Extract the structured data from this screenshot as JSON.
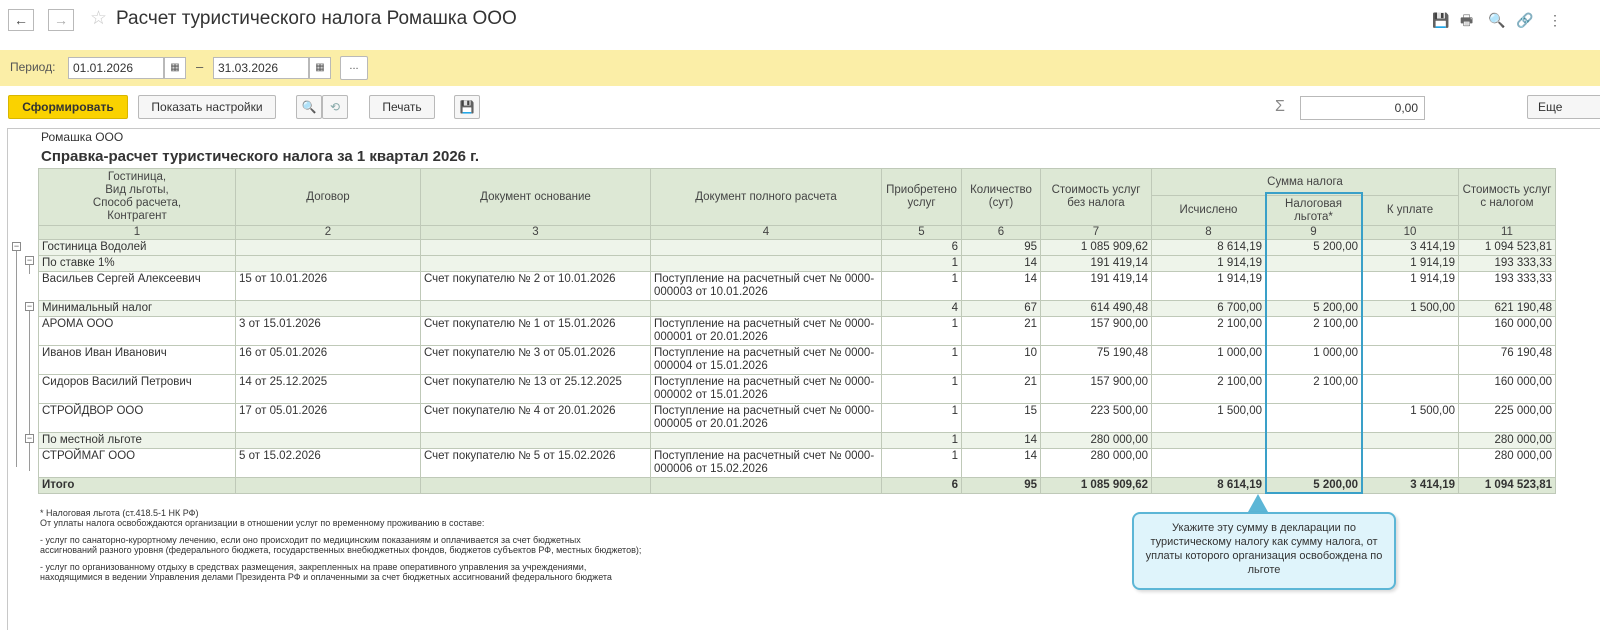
{
  "window": {
    "title": "Расчет туристического налога Ромашка ООО",
    "back_icon": "←",
    "forward_icon": "→",
    "star_icon": "☆",
    "toolbar_icons": [
      "💾",
      "🖶",
      "🔍",
      "🔗",
      "⋮"
    ]
  },
  "period": {
    "label": "Период:",
    "from": "01.01.2026",
    "to": "31.03.2026",
    "dash": "–",
    "dots": "..."
  },
  "toolbar": {
    "generate_label": "Сформировать",
    "settings_label": "Показать настройки",
    "search_icon": "🔍",
    "search_clear_icon": "⟲",
    "print_label": "Печать",
    "save_icon": "💾",
    "sigma": "Σ",
    "sum_value": "0,00",
    "more_label": "Еще"
  },
  "report": {
    "organization": "Ромашка ООО",
    "title": "Справка-расчет туристического налога за 1 квартал 2026 г.",
    "headers": {
      "col1": "Гостиница,\nВид льготы,\nСпособ расчета,\nКонтрагент",
      "col2": "Договор",
      "col3": "Документ основание",
      "col4": "Документ полного расчета",
      "col5": "Приобретено услуг",
      "col6": "Количество (сут)",
      "col7": "Стоимость услуг без налога",
      "tax_group": "Сумма налога",
      "col8": "Исчислено",
      "col9": "Налоговая льгота*",
      "col10": "К уплате",
      "col11": "Стоимость услуг с налогом"
    },
    "col_numbers": [
      "1",
      "2",
      "3",
      "4",
      "5",
      "6",
      "7",
      "8",
      "9",
      "10",
      "11"
    ],
    "rows": [
      {
        "level": 0,
        "name": "Гостиница Водолей",
        "contract": "",
        "basis": "",
        "payment": "",
        "services": "6",
        "days": "95",
        "cost": "1 085 909,62",
        "calc": "8 614,19",
        "benefit": "5 200,00",
        "pay": "3 414,19",
        "total": "1 094 523,81"
      },
      {
        "level": 1,
        "name": "По ставке 1%",
        "contract": "",
        "basis": "",
        "payment": "",
        "services": "1",
        "days": "14",
        "cost": "191 419,14",
        "calc": "1 914,19",
        "benefit": "",
        "pay": "1 914,19",
        "total": "193 333,33"
      },
      {
        "level": 2,
        "name": "Васильев Сергей Алексеевич",
        "contract": "15 от 10.01.2026",
        "basis": "Счет покупателю № 2 от 10.01.2026",
        "payment": "Поступление на расчетный счет № 0000-000003 от 10.01.2026",
        "services": "1",
        "days": "14",
        "cost": "191 419,14",
        "calc": "1 914,19",
        "benefit": "",
        "pay": "1 914,19",
        "total": "193 333,33"
      },
      {
        "level": 1,
        "name": "Минимальный налог",
        "contract": "",
        "basis": "",
        "payment": "",
        "services": "4",
        "days": "67",
        "cost": "614 490,48",
        "calc": "6 700,00",
        "benefit": "5 200,00",
        "pay": "1 500,00",
        "total": "621 190,48"
      },
      {
        "level": 2,
        "name": "АРОМА ООО",
        "contract": "3 от 15.01.2026",
        "basis": "Счет покупателю № 1 от 15.01.2026",
        "payment": "Поступление на расчетный счет № 0000-000001 от 20.01.2026",
        "services": "1",
        "days": "21",
        "cost": "157 900,00",
        "calc": "2 100,00",
        "benefit": "2 100,00",
        "pay": "",
        "total": "160 000,00"
      },
      {
        "level": 2,
        "name": "Иванов Иван Иванович",
        "contract": "16 от 05.01.2026",
        "basis": "Счет покупателю № 3 от 05.01.2026",
        "payment": "Поступление на расчетный счет № 0000-000004 от 15.01.2026",
        "services": "1",
        "days": "10",
        "cost": "75 190,48",
        "calc": "1 000,00",
        "benefit": "1 000,00",
        "pay": "",
        "total": "76 190,48"
      },
      {
        "level": 2,
        "name": "Сидоров Василий Петрович",
        "contract": "14 от 25.12.2025",
        "basis": "Счет покупателю № 13 от 25.12.2025",
        "payment": "Поступление на расчетный счет № 0000-000002 от 15.01.2026",
        "services": "1",
        "days": "21",
        "cost": "157 900,00",
        "calc": "2 100,00",
        "benefit": "2 100,00",
        "pay": "",
        "total": "160 000,00"
      },
      {
        "level": 2,
        "name": "СТРОЙДВОР ООО",
        "contract": "17 от 05.01.2026",
        "basis": "Счет покупателю № 4 от 20.01.2026",
        "payment": "Поступление на расчетный счет № 0000-000005 от 20.01.2026",
        "services": "1",
        "days": "15",
        "cost": "223 500,00",
        "calc": "1 500,00",
        "benefit": "",
        "pay": "1 500,00",
        "total": "225 000,00"
      },
      {
        "level": 1,
        "name": "По местной льготе",
        "contract": "",
        "basis": "",
        "payment": "",
        "services": "1",
        "days": "14",
        "cost": "280 000,00",
        "calc": "",
        "benefit": "",
        "pay": "",
        "total": "280 000,00"
      },
      {
        "level": 2,
        "name": "СТРОЙМАГ ООО",
        "contract": "5 от 15.02.2026",
        "basis": "Счет покупателю № 5 от 15.02.2026",
        "payment": "Поступление на расчетный счет № 0000-000006 от 15.02.2026",
        "services": "1",
        "days": "14",
        "cost": "280 000,00",
        "calc": "",
        "benefit": "",
        "pay": "",
        "total": "280 000,00"
      }
    ],
    "total": {
      "name": "Итого",
      "services": "6",
      "days": "95",
      "cost": "1 085 909,62",
      "calc": "8 614,19",
      "benefit": "5 200,00",
      "pay": "3 414,19",
      "total": "1 094 523,81"
    },
    "footnote": [
      "* Налоговая льгота (ст.418.5-1 НК РФ)",
      "От уплаты налога освобождаются организации в отношении услуг по временному проживанию в составе:",
      "",
      "- услуг по санаторно-курортному лечению, если оно происходит по медицинским показаниям и оплачивается за счет бюджетных",
      "ассигнований разного уровня (федерального бюджета, государственных внебюджетных фондов, бюджетов субъектов РФ, местных бюджетов);",
      "",
      "- услуг по организованному отдыху в средствах размещения, закрепленных на праве оперативного управления за учреждениями,",
      "находящимися в ведении Управления делами Президента РФ и оплаченными за счет бюджетных ассигнований федерального бюджета"
    ]
  },
  "callout": {
    "text": "Укажите эту сумму в декларации по туристическому налогу как сумму налога, от уплаты которого организация освобождена по льготе"
  },
  "colors": {
    "accent_yellow": "#fad200",
    "period_bg": "#fbeea7",
    "header_green": "#dde8d5",
    "highlight_blue": "#3aa0c8",
    "callout_bg": "#dff4fb"
  }
}
